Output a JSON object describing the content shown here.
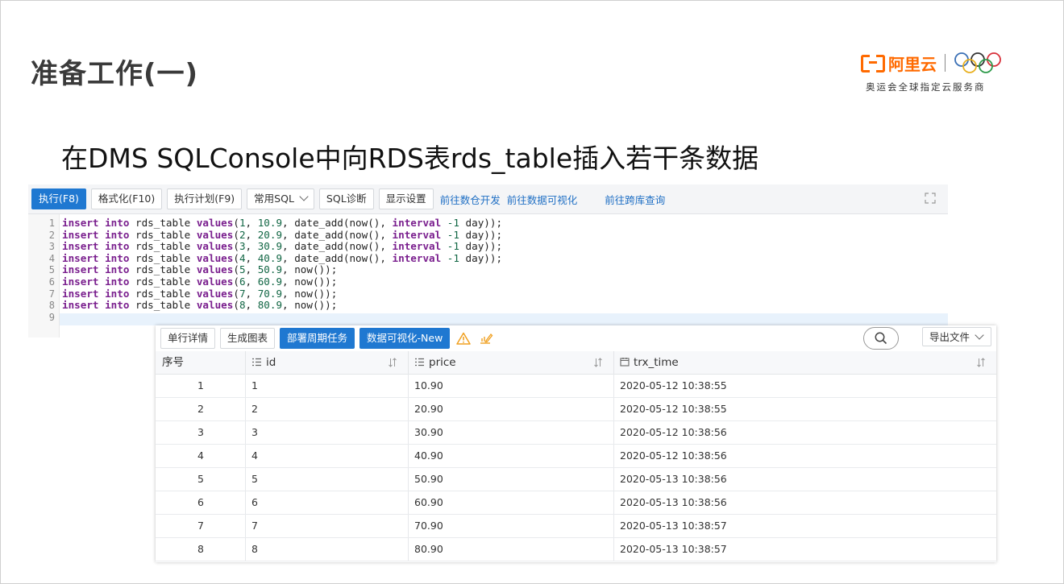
{
  "slide": {
    "title": "准备工作(一)",
    "subtitle": "在DMS SQLConsole中向RDS表rds_table插入若干条数据"
  },
  "brand": {
    "name": "阿里云",
    "tagline": "奥运会全球指定云服务商",
    "color": "#ff6a00"
  },
  "toolbar": {
    "execute": "执行(F8)",
    "format": "格式化(F10)",
    "plan": "执行计划(F9)",
    "common_sql": "常用SQL",
    "diagnose": "SQL诊断",
    "display_settings": "显示设置",
    "link_warehouse": "前往数仓开发",
    "link_visualize": "前往数据可视化",
    "link_cross_db": "前往跨库查询"
  },
  "editor": {
    "line_numbers": [
      "1",
      "2",
      "3",
      "4",
      "5",
      "6",
      "7",
      "8",
      "9"
    ],
    "lines": [
      [
        {
          "t": "insert",
          "k": "kw"
        },
        {
          "t": " "
        },
        {
          "t": "into",
          "k": "kw"
        },
        {
          "t": " rds_table "
        },
        {
          "t": "values",
          "k": "kw"
        },
        {
          "t": "("
        },
        {
          "t": "1",
          "k": "num"
        },
        {
          "t": ", "
        },
        {
          "t": "10.9",
          "k": "num"
        },
        {
          "t": ", date_add(now(), "
        },
        {
          "t": "interval",
          "k": "kw"
        },
        {
          "t": " "
        },
        {
          "t": "-1",
          "k": "num"
        },
        {
          "t": " day));"
        }
      ],
      [
        {
          "t": "insert",
          "k": "kw"
        },
        {
          "t": " "
        },
        {
          "t": "into",
          "k": "kw"
        },
        {
          "t": " rds_table "
        },
        {
          "t": "values",
          "k": "kw"
        },
        {
          "t": "("
        },
        {
          "t": "2",
          "k": "num"
        },
        {
          "t": ", "
        },
        {
          "t": "20.9",
          "k": "num"
        },
        {
          "t": ", date_add(now(), "
        },
        {
          "t": "interval",
          "k": "kw"
        },
        {
          "t": " "
        },
        {
          "t": "-1",
          "k": "num"
        },
        {
          "t": " day));"
        }
      ],
      [
        {
          "t": "insert",
          "k": "kw"
        },
        {
          "t": " "
        },
        {
          "t": "into",
          "k": "kw"
        },
        {
          "t": " rds_table "
        },
        {
          "t": "values",
          "k": "kw"
        },
        {
          "t": "("
        },
        {
          "t": "3",
          "k": "num"
        },
        {
          "t": ", "
        },
        {
          "t": "30.9",
          "k": "num"
        },
        {
          "t": ", date_add(now(), "
        },
        {
          "t": "interval",
          "k": "kw"
        },
        {
          "t": " "
        },
        {
          "t": "-1",
          "k": "num"
        },
        {
          "t": " day));"
        }
      ],
      [
        {
          "t": "insert",
          "k": "kw"
        },
        {
          "t": " "
        },
        {
          "t": "into",
          "k": "kw"
        },
        {
          "t": " rds_table "
        },
        {
          "t": "values",
          "k": "kw"
        },
        {
          "t": "("
        },
        {
          "t": "4",
          "k": "num"
        },
        {
          "t": ", "
        },
        {
          "t": "40.9",
          "k": "num"
        },
        {
          "t": ", date_add(now(), "
        },
        {
          "t": "interval",
          "k": "kw"
        },
        {
          "t": " "
        },
        {
          "t": "-1",
          "k": "num"
        },
        {
          "t": " day));"
        }
      ],
      [
        {
          "t": "insert",
          "k": "kw"
        },
        {
          "t": " "
        },
        {
          "t": "into",
          "k": "kw"
        },
        {
          "t": " rds_table "
        },
        {
          "t": "values",
          "k": "kw"
        },
        {
          "t": "("
        },
        {
          "t": "5",
          "k": "num"
        },
        {
          "t": ", "
        },
        {
          "t": "50.9",
          "k": "num"
        },
        {
          "t": ", now());"
        }
      ],
      [
        {
          "t": "insert",
          "k": "kw"
        },
        {
          "t": " "
        },
        {
          "t": "into",
          "k": "kw"
        },
        {
          "t": " rds_table "
        },
        {
          "t": "values",
          "k": "kw"
        },
        {
          "t": "("
        },
        {
          "t": "6",
          "k": "num"
        },
        {
          "t": ", "
        },
        {
          "t": "60.9",
          "k": "num"
        },
        {
          "t": ", now());"
        }
      ],
      [
        {
          "t": "insert",
          "k": "kw"
        },
        {
          "t": " "
        },
        {
          "t": "into",
          "k": "kw"
        },
        {
          "t": " rds_table "
        },
        {
          "t": "values",
          "k": "kw"
        },
        {
          "t": "("
        },
        {
          "t": "7",
          "k": "num"
        },
        {
          "t": ", "
        },
        {
          "t": "70.9",
          "k": "num"
        },
        {
          "t": ", now());"
        }
      ],
      [
        {
          "t": "insert",
          "k": "kw"
        },
        {
          "t": " "
        },
        {
          "t": "into",
          "k": "kw"
        },
        {
          "t": " rds_table "
        },
        {
          "t": "values",
          "k": "kw"
        },
        {
          "t": "("
        },
        {
          "t": "8",
          "k": "num"
        },
        {
          "t": ", "
        },
        {
          "t": "80.9",
          "k": "num"
        },
        {
          "t": ", now());"
        }
      ],
      []
    ]
  },
  "result": {
    "toolbar": {
      "row_detail": "单行详情",
      "gen_chart": "生成图表",
      "deploy_task": "部署周期任务",
      "visualize_new": "数据可视化-New",
      "export": "导出文件"
    },
    "columns": [
      "序号",
      "id",
      "price",
      "trx_time"
    ],
    "rows": [
      [
        "1",
        "1",
        "10.90",
        "2020-05-12 10:38:55"
      ],
      [
        "2",
        "2",
        "20.90",
        "2020-05-12 10:38:55"
      ],
      [
        "3",
        "3",
        "30.90",
        "2020-05-12 10:38:56"
      ],
      [
        "4",
        "4",
        "40.90",
        "2020-05-12 10:38:56"
      ],
      [
        "5",
        "5",
        "50.90",
        "2020-05-13 10:38:56"
      ],
      [
        "6",
        "6",
        "60.90",
        "2020-05-13 10:38:56"
      ],
      [
        "7",
        "7",
        "70.90",
        "2020-05-13 10:38:57"
      ],
      [
        "8",
        "8",
        "80.90",
        "2020-05-13 10:38:57"
      ]
    ]
  }
}
